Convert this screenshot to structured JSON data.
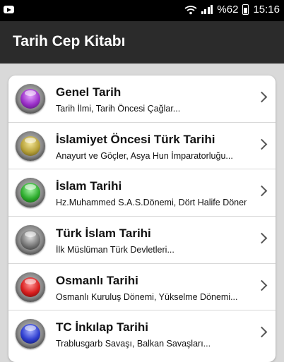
{
  "status": {
    "battery": "%62",
    "time": "15:16"
  },
  "appbar": {
    "title": "Tarih Cep Kitabı"
  },
  "items": [
    {
      "title": "Genel Tarih",
      "subtitle": "Tarih İlmi, Tarih Öncesi Çağlar...",
      "color": "#9b30c9"
    },
    {
      "title": "İslamiyet Öncesi Türk Tarihi",
      "subtitle": "Anayurt ve Göçler, Asya Hun İmparatorluğu...",
      "color": "#b8a23a"
    },
    {
      "title": "İslam Tarihi",
      "subtitle": "Hz.Muhammed S.A.S.Dönemi, Dört Halife Dönemi...",
      "color": "#2fae2f"
    },
    {
      "title": "Türk İslam Tarihi",
      "subtitle": "İlk Müslüman Türk Devletleri...",
      "color": "#7a7a7a"
    },
    {
      "title": "Osmanlı Tarihi",
      "subtitle": "Osmanlı Kuruluş Dönemi, Yükselme Dönemi...",
      "color": "#d91e1e"
    },
    {
      "title": "TC İnkılap Tarihi",
      "subtitle": "Trablusgarb Savaşı, Balkan Savaşları...",
      "color": "#2f3fd0"
    }
  ]
}
